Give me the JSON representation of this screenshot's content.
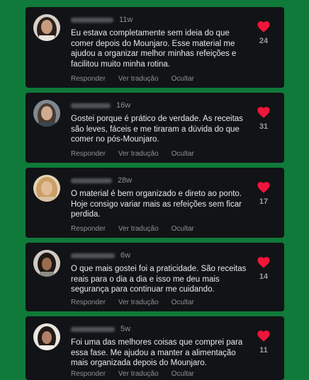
{
  "colors": {
    "background": "#0f7a3a",
    "card": "#121316",
    "heart": "#f0153a",
    "text": "#e8e9ec",
    "muted": "#8e9096"
  },
  "comments": [
    {
      "time": "11w",
      "text": "Eu estava completamente sem ideia do que comer depois do Mounjaro. Esse material me ajudou a organizar melhor minhas refeições e facilitou muito minha rotina.",
      "likes": "24",
      "reply": "Responder",
      "translate": "Ver tradução",
      "hide": "Ocultar",
      "icon": "heart-icon"
    },
    {
      "time": "16w",
      "text": "Gostei porque é prático de verdade. As receitas são leves, fáceis e me tiraram a dúvida do que comer no pós-Mounjaro.",
      "likes": "31",
      "reply": "Responder",
      "translate": "Ver tradução",
      "hide": "Ocultar",
      "icon": "heart-icon"
    },
    {
      "time": "28w",
      "text": "O material é bem organizado e direto ao ponto. Hoje consigo variar mais as refeições sem ficar perdida.",
      "likes": "17",
      "reply": "Responder",
      "translate": "Ver tradução",
      "hide": "Ocultar",
      "icon": "heart-icon"
    },
    {
      "time": "6w",
      "text": "O que mais gostei foi a praticidade. São receitas reais para o dia a dia e isso me deu mais segurança para continuar me cuidando.",
      "likes": "14",
      "reply": "Responder",
      "translate": "Ver tradução",
      "hide": "Ocultar",
      "icon": "heart-icon"
    },
    {
      "time": "5w",
      "text": "Foi uma das melhores coisas que comprei para essa fase. Me ajudou a manter a alimentação mais organizada depois do Mounjaro.",
      "likes": "11",
      "reply": "Responder",
      "translate": "Ver tradução",
      "hide": "Ocultar",
      "icon": "heart-icon"
    }
  ]
}
